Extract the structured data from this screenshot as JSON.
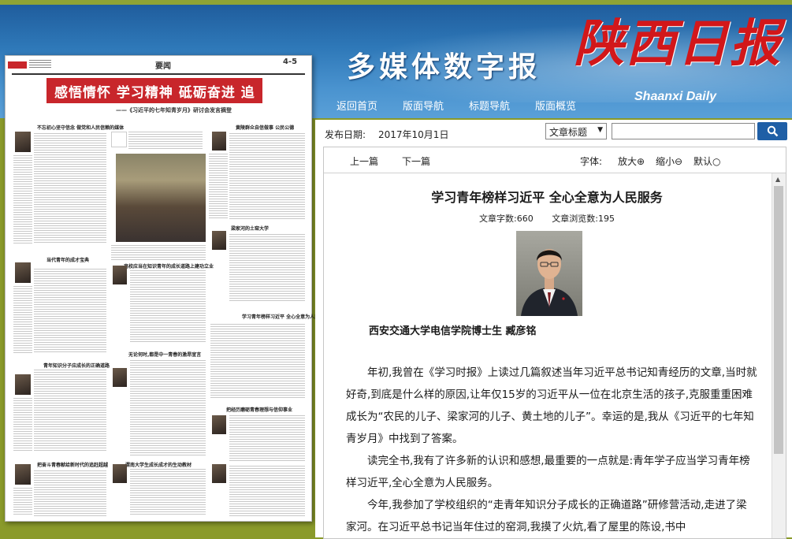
{
  "header": {
    "title": "多媒体数字报",
    "logo_text": "陕西日报",
    "logo_english": "Shaanxi Daily",
    "brand_red": "#d2171a",
    "header_blue": "#2e78b8"
  },
  "nav": {
    "items": [
      "返回首页",
      "版面导航",
      "标题导航",
      "版面概览"
    ]
  },
  "newspaper_page": {
    "page_name": "要闻",
    "page_number": "4-5",
    "banner_title": "感悟情怀 学习精神 砥砺奋进 追赶超越",
    "banner_subtitle": "——《习近平的七年知青岁月》研讨会发言摘登",
    "headlines": [
      "不忘初心坚守信念 做党和人民信赖的媒体",
      "当代青年的成才宝典",
      "青年知识分子应成长的正确道路",
      "把奋斗青春献给新时代的追赶超越",
      "高校应当在知识青年的成长道路上建功立业",
      "无论何时,都是中一青春的激昂宣言",
      "渭南大学生成长成才的生动教材",
      "黄陵群众自信做事 公民公德",
      "梁家河的土窑大学",
      "学习青年榜样习近平 全心全意为人民服务",
      "把经历磨砺青春理想与信仰事业"
    ]
  },
  "toolbar": {
    "date_label": "发布日期:",
    "date_value": "2017年10月1日",
    "search_select": "文章标题",
    "search_placeholder": ""
  },
  "article_nav": {
    "prev": "上一篇",
    "next": "下一篇",
    "font_label": "字体:",
    "zoom_in": "放大",
    "zoom_out": "缩小",
    "reset": "默认"
  },
  "article": {
    "title": "学习青年榜样习近平 全心全意为人民服务",
    "word_count": "文章字数:660",
    "view_count": "文章浏览数:195",
    "photo_caption": "西安交通大学电信学院博士生 臧彦铭",
    "paragraphs": [
      "年初,我曾在《学习时报》上读过几篇叙述当年习近平总书记知青经历的文章,当时就好奇,到底是什么样的原因,让年仅15岁的习近平从一位在北京生活的孩子,克服重重困难成长为“农民的儿子、梁家河的儿子、黄土地的儿子”。幸运的是,我从《习近平的七年知青岁月》中找到了答案。",
      "读完全书,我有了许多新的认识和感想,最重要的一点就是:青年学子应当学习青年榜样习近平,全心全意为人民服务。",
      "今年,我参加了学校组织的“走青年知识分子成长的正确道路”研修营活动,走进了梁家河。在习近平总书记当年住过的窑洞,我摸了火炕,看了屋里的陈设,书中"
    ]
  }
}
